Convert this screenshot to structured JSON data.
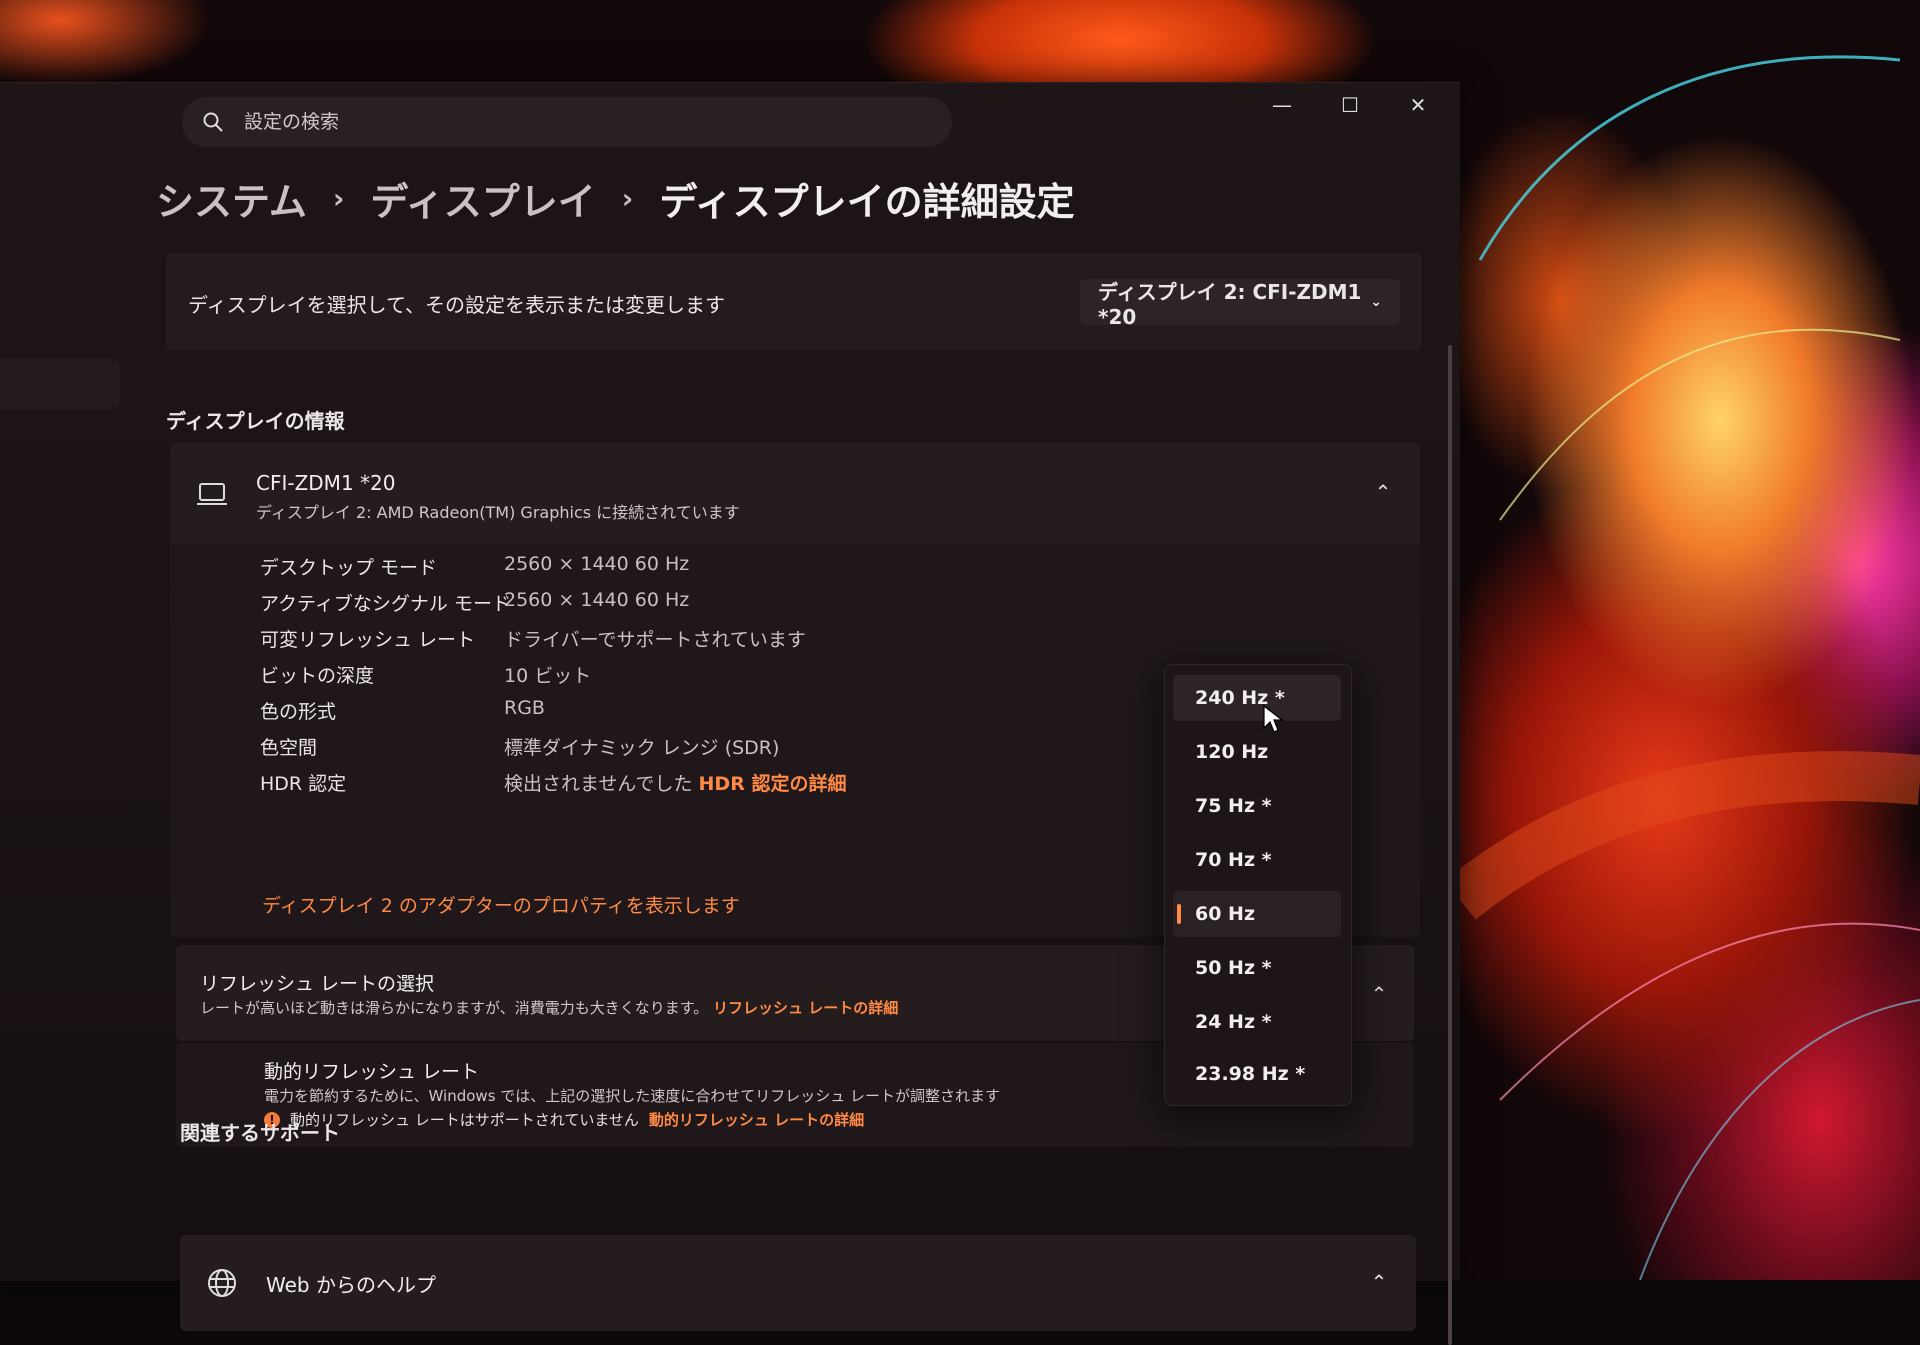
{
  "search": {
    "placeholder": "設定の検索"
  },
  "breadcrumb": {
    "items": [
      "システム",
      "ディスプレイ",
      "ディスプレイの詳細設定"
    ]
  },
  "select_display": {
    "label": "ディスプレイを選択して、その設定を表示または変更します",
    "value": "ディスプレイ 2: CFI-ZDM1 *20"
  },
  "display_info": {
    "section_title": "ディスプレイの情報",
    "monitor_name": "CFI-ZDM1 *20",
    "connected_to": "ディスプレイ 2: AMD Radeon(TM) Graphics に接続されています",
    "properties": [
      {
        "key": "デスクトップ モード",
        "value": "2560 × 1440 60 Hz"
      },
      {
        "key": "アクティブなシグナル モード",
        "value": "2560 × 1440 60 Hz"
      },
      {
        "key": "可変リフレッシュ レート",
        "value": "ドライバーでサポートされています"
      },
      {
        "key": "ビットの深度",
        "value": "10 ビット"
      },
      {
        "key": "色の形式",
        "value": "RGB"
      },
      {
        "key": "色空間",
        "value": "標準ダイナミック レンジ (SDR)"
      },
      {
        "key": "HDR 認定",
        "value": "検出されませんでした",
        "link": "HDR 認定の詳細"
      }
    ],
    "adapter_link": "ディスプレイ 2 のアダプターのプロパティを表示します"
  },
  "refresh_rate": {
    "title": "リフレッシュ レートの選択",
    "description": "レートが高いほど動きは滑らかになりますが、消費電力も大きくなります。",
    "link": "リフレッシュ レートの詳細",
    "options": [
      "240 Hz *",
      "120 Hz",
      "75 Hz *",
      "70 Hz *",
      "60 Hz",
      "50 Hz *",
      "24 Hz *",
      "23.98 Hz *"
    ],
    "selected": "60 Hz",
    "hovered": "240 Hz *"
  },
  "dynamic_refresh": {
    "title": "動的リフレッシュ レート",
    "description": "電力を節約するために、Windows では、上記の選択した速度に合わせてリフレッシュ レートが調整されます",
    "warning": "動的リフレッシュ レートはサポートされていません",
    "link": "動的リフレッシュ レートの詳細"
  },
  "related_support": {
    "section_title": "関連するサポート",
    "help_label": "Web からのヘルプ"
  },
  "colors": {
    "accent": "#ff8a45",
    "window_bg": "#1e1517",
    "card_bg": "#241b1d"
  },
  "icons": {
    "search": "search-icon",
    "minimize": "minimize-icon",
    "maximize": "maximize-icon",
    "close": "close-icon",
    "laptop": "laptop-icon",
    "chevron_up": "chevron-up-icon",
    "chevron_down": "chevron-down-icon",
    "globe": "globe-icon",
    "warning": "warning-icon"
  }
}
